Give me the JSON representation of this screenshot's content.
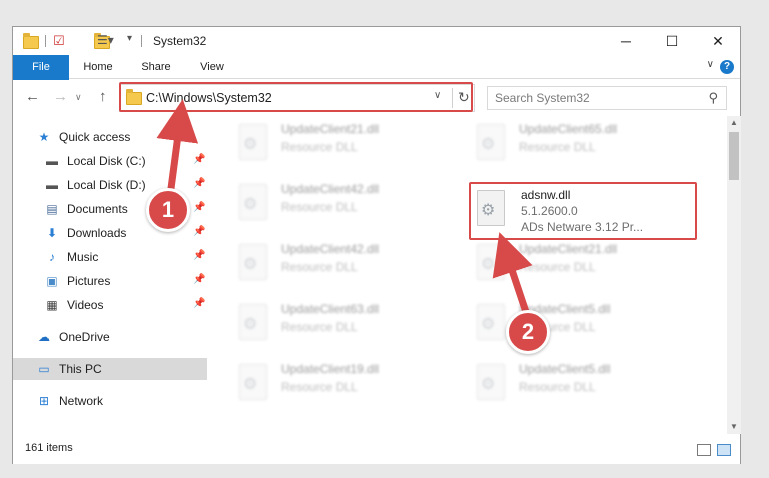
{
  "window": {
    "title": "System32",
    "controls": {
      "minimize": "─",
      "maximize": "☐",
      "close": "✕"
    }
  },
  "ribbon": {
    "tabs": [
      {
        "label": "File"
      },
      {
        "label": "Home"
      },
      {
        "label": "Share"
      },
      {
        "label": "View"
      }
    ],
    "help": "?"
  },
  "address": {
    "path": "C:\\Windows\\System32",
    "search_placeholder": "Search System32"
  },
  "nav": {
    "items": [
      {
        "label": "Quick access",
        "icon": "star-icon"
      },
      {
        "label": "Local Disk (C:)",
        "icon": "drive-icon"
      },
      {
        "label": "Local Disk (D:)",
        "icon": "drive-icon"
      },
      {
        "label": "Documents",
        "icon": "documents-icon"
      },
      {
        "label": "Downloads",
        "icon": "download-icon"
      },
      {
        "label": "Music",
        "icon": "music-icon"
      },
      {
        "label": "Pictures",
        "icon": "pictures-icon"
      },
      {
        "label": "Videos",
        "icon": "videos-icon"
      },
      {
        "label": "OneDrive",
        "icon": "cloud-icon"
      },
      {
        "label": "This PC",
        "icon": "computer-icon"
      },
      {
        "label": "Network",
        "icon": "network-icon"
      }
    ]
  },
  "files": [
    {
      "name": "UpdateClient21.dll",
      "desc": "Resource DLL"
    },
    {
      "name": "UpdateClient65.dll",
      "desc": "Resource DLL"
    },
    {
      "name": "UpdateClient42.dll",
      "desc": "Resource DLL"
    },
    {
      "name": "adsnw.dll",
      "desc": "5.1.2600.0",
      "desc2": "ADs Netware 3.12 Pr..."
    },
    {
      "name": "UpdateClient42.dll",
      "desc": "Resource DLL"
    },
    {
      "name": "UpdateClient21.dll",
      "desc": "Resource DLL"
    },
    {
      "name": "UpdateClient63.dll",
      "desc": "Resource DLL"
    },
    {
      "name": "UpdateClient5.dll",
      "desc": "Resource DLL"
    },
    {
      "name": "UpdateClient19.dll",
      "desc": "Resource DLL"
    },
    {
      "name": "UpdateClient5.dll",
      "desc": "Resource DLL"
    }
  ],
  "status": {
    "count": "161 items"
  },
  "annotations": {
    "badge1": "1",
    "badge2": "2"
  },
  "colors": {
    "accent": "#1979ca",
    "highlight": "#d84a4a"
  }
}
